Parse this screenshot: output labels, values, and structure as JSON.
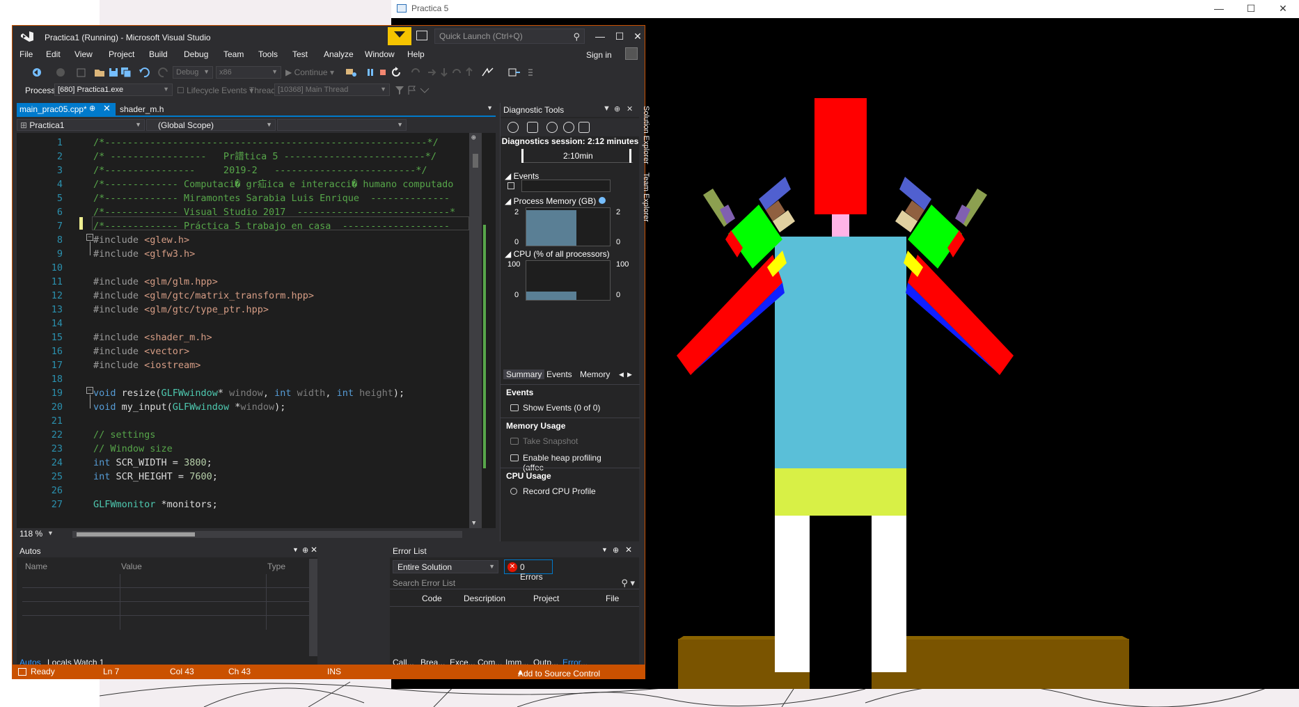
{
  "gl_window": {
    "title": "Practica 5",
    "minimize": "—",
    "maximize": "☐",
    "close": "✕"
  },
  "vs": {
    "title": "Practica1 (Running) - Microsoft Visual Studio",
    "quick_launch_placeholder": "Quick Launch (Ctrl+Q)",
    "sign_in": "Sign in",
    "minimize": "—",
    "maximize": "☐",
    "close": "✕",
    "menu": [
      "File",
      "Edit",
      "View",
      "Project",
      "Build",
      "Debug",
      "Team",
      "Tools",
      "Test",
      "Analyze",
      "Window",
      "Help"
    ],
    "toolbar": {
      "config": "Debug",
      "platform": "x86",
      "continue": "Continue"
    },
    "process_bar": {
      "process_label": "Process:",
      "process_value": "[680] Practica1.exe",
      "lifecycle": "Lifecycle Events",
      "thread_label": "Thread:",
      "thread_value": "[10368] Main Thread"
    },
    "tabs": [
      {
        "label": "main_prac05.cpp*",
        "pin": "⊕",
        "close": "✕"
      },
      {
        "label": "shader_m.h"
      }
    ],
    "nav": {
      "project": "Practica1",
      "scope": "(Global Scope)"
    },
    "zoom": "118 %",
    "code_lines": [
      {
        "n": "1",
        "segs": [
          [
            "c-com",
            "/*---------------------------------------------------------*/"
          ]
        ]
      },
      {
        "n": "2",
        "segs": [
          [
            "c-com",
            "/* -----------------   Pr譜tica 5 -------------------------*/"
          ]
        ]
      },
      {
        "n": "3",
        "segs": [
          [
            "c-com",
            "/*----------------     2019-2   -------------------------*/"
          ]
        ]
      },
      {
        "n": "4",
        "segs": [
          [
            "c-com",
            "/*------------- Computaci� gr疝ica e interacci� humano computado"
          ]
        ]
      },
      {
        "n": "5",
        "segs": [
          [
            "c-com",
            "/*------------- Miramontes Sarabia Luis Enrique  --------------"
          ]
        ]
      },
      {
        "n": "6",
        "segs": [
          [
            "c-com",
            "/*------------- Visual Studio 2017  ---------------------------*"
          ]
        ]
      },
      {
        "n": "7",
        "segs": [
          [
            "c-com",
            "/*------------- Práctica 5 trabajo en casa  -------------------"
          ]
        ]
      },
      {
        "n": "8",
        "segs": [
          [
            "c-pp",
            "#include "
          ],
          [
            "c-inc",
            "<glew.h>"
          ]
        ]
      },
      {
        "n": "9",
        "segs": [
          [
            "c-pp",
            "#include "
          ],
          [
            "c-inc",
            "<glfw3.h>"
          ]
        ]
      },
      {
        "n": "10",
        "segs": []
      },
      {
        "n": "11",
        "segs": [
          [
            "c-pp",
            "#include "
          ],
          [
            "c-inc",
            "<glm/glm.hpp>"
          ]
        ]
      },
      {
        "n": "12",
        "segs": [
          [
            "c-pp",
            "#include "
          ],
          [
            "c-inc",
            "<glm/gtc/matrix_transform.hpp>"
          ]
        ]
      },
      {
        "n": "13",
        "segs": [
          [
            "c-pp",
            "#include "
          ],
          [
            "c-inc",
            "<glm/gtc/type_ptr.hpp>"
          ]
        ]
      },
      {
        "n": "14",
        "segs": []
      },
      {
        "n": "15",
        "segs": [
          [
            "c-pp",
            "#include "
          ],
          [
            "c-inc",
            "<shader_m.h>"
          ]
        ]
      },
      {
        "n": "16",
        "segs": [
          [
            "c-pp",
            "#include "
          ],
          [
            "c-inc",
            "<vector>"
          ]
        ]
      },
      {
        "n": "17",
        "segs": [
          [
            "c-pp",
            "#include "
          ],
          [
            "c-inc",
            "<iostream>"
          ]
        ]
      },
      {
        "n": "18",
        "segs": []
      },
      {
        "n": "19",
        "segs": [
          [
            "c-kw",
            "void"
          ],
          [
            "c-tx",
            " resize("
          ],
          [
            "c-ty",
            "GLFWwindow"
          ],
          [
            "c-tx",
            "* "
          ],
          [
            "c-par",
            "window"
          ],
          [
            "c-tx",
            ", "
          ],
          [
            "c-kw",
            "int"
          ],
          [
            "c-tx",
            " "
          ],
          [
            "c-par",
            "width"
          ],
          [
            "c-tx",
            ", "
          ],
          [
            "c-kw",
            "int"
          ],
          [
            "c-tx",
            " "
          ],
          [
            "c-par",
            "height"
          ],
          [
            "c-tx",
            ");"
          ]
        ]
      },
      {
        "n": "20",
        "segs": [
          [
            "c-kw",
            "void"
          ],
          [
            "c-tx",
            " my_input("
          ],
          [
            "c-ty",
            "GLFWwindow"
          ],
          [
            "c-tx",
            " *"
          ],
          [
            "c-par",
            "window"
          ],
          [
            "c-tx",
            ");"
          ]
        ]
      },
      {
        "n": "21",
        "segs": []
      },
      {
        "n": "22",
        "segs": [
          [
            "c-com",
            "// settings"
          ]
        ]
      },
      {
        "n": "23",
        "segs": [
          [
            "c-com",
            "// Window size"
          ]
        ]
      },
      {
        "n": "24",
        "segs": [
          [
            "c-kw",
            "int"
          ],
          [
            "c-tx",
            " SCR_WIDTH = "
          ],
          [
            "c-num",
            "3800"
          ],
          [
            "c-tx",
            ";"
          ]
        ]
      },
      {
        "n": "25",
        "segs": [
          [
            "c-kw",
            "int"
          ],
          [
            "c-tx",
            " SCR_HEIGHT = "
          ],
          [
            "c-num",
            "7600"
          ],
          [
            "c-tx",
            ";"
          ]
        ]
      },
      {
        "n": "26",
        "segs": []
      },
      {
        "n": "27",
        "segs": [
          [
            "c-ty",
            "GLFWmonitor"
          ],
          [
            "c-tx",
            " *monitors;"
          ]
        ]
      }
    ],
    "diag": {
      "title": "Diagnostic Tools",
      "session": "Diagnostics session: 2:12 minutes",
      "timeline_label": "2:10min",
      "events": "Events",
      "process_memory": "Process Memory (GB)",
      "mem_max": "2",
      "mem_min": "0",
      "mem_level": 0.94,
      "cpu": "CPU (% of all processors)",
      "cpu_max": "100",
      "cpu_min": "0",
      "cpu_level": 0.22,
      "subtabs": [
        "Summary",
        "Events",
        "Memory"
      ],
      "sec_events": "Events",
      "show_events": "Show Events (0 of 0)",
      "sec_memory": "Memory Usage",
      "take_snapshot": "Take Snapshot",
      "heap_profiling": "Enable heap profiling (affec",
      "sec_cpu": "CPU Usage",
      "record_cpu": "Record CPU Profile"
    },
    "side_tabs": [
      "Solution Explorer",
      "Team Explorer"
    ],
    "autos": {
      "title": "Autos",
      "col_name": "Name",
      "col_value": "Value",
      "col_type": "Type",
      "tabs": [
        "Autos",
        "Locals",
        "Watch 1"
      ]
    },
    "errors": {
      "title": "Error List",
      "scope": "Entire Solution",
      "count": "0 Errors",
      "search_placeholder": "Search Error List",
      "cols": [
        "Code",
        "Description",
        "Project",
        "File"
      ],
      "tabs": [
        "Call...",
        "Brea...",
        "Exce...",
        "Com...",
        "Imm...",
        "Outp...",
        "Error..."
      ]
    },
    "status": {
      "ready": "Ready",
      "ln": "Ln 7",
      "col": "Col 43",
      "ch": "Ch 43",
      "ins": "INS",
      "source_control": "Add to Source Control"
    }
  },
  "colors": {
    "vs_accent": "#ca5100",
    "vs_blue": "#007acc",
    "robot_head": "#ff0000",
    "robot_neck": "#ffb3e6",
    "robot_torso": "#5abfd8",
    "robot_hips": "#d8f046",
    "robot_legs": "#ffffff",
    "robot_ground": "#7a5400"
  }
}
